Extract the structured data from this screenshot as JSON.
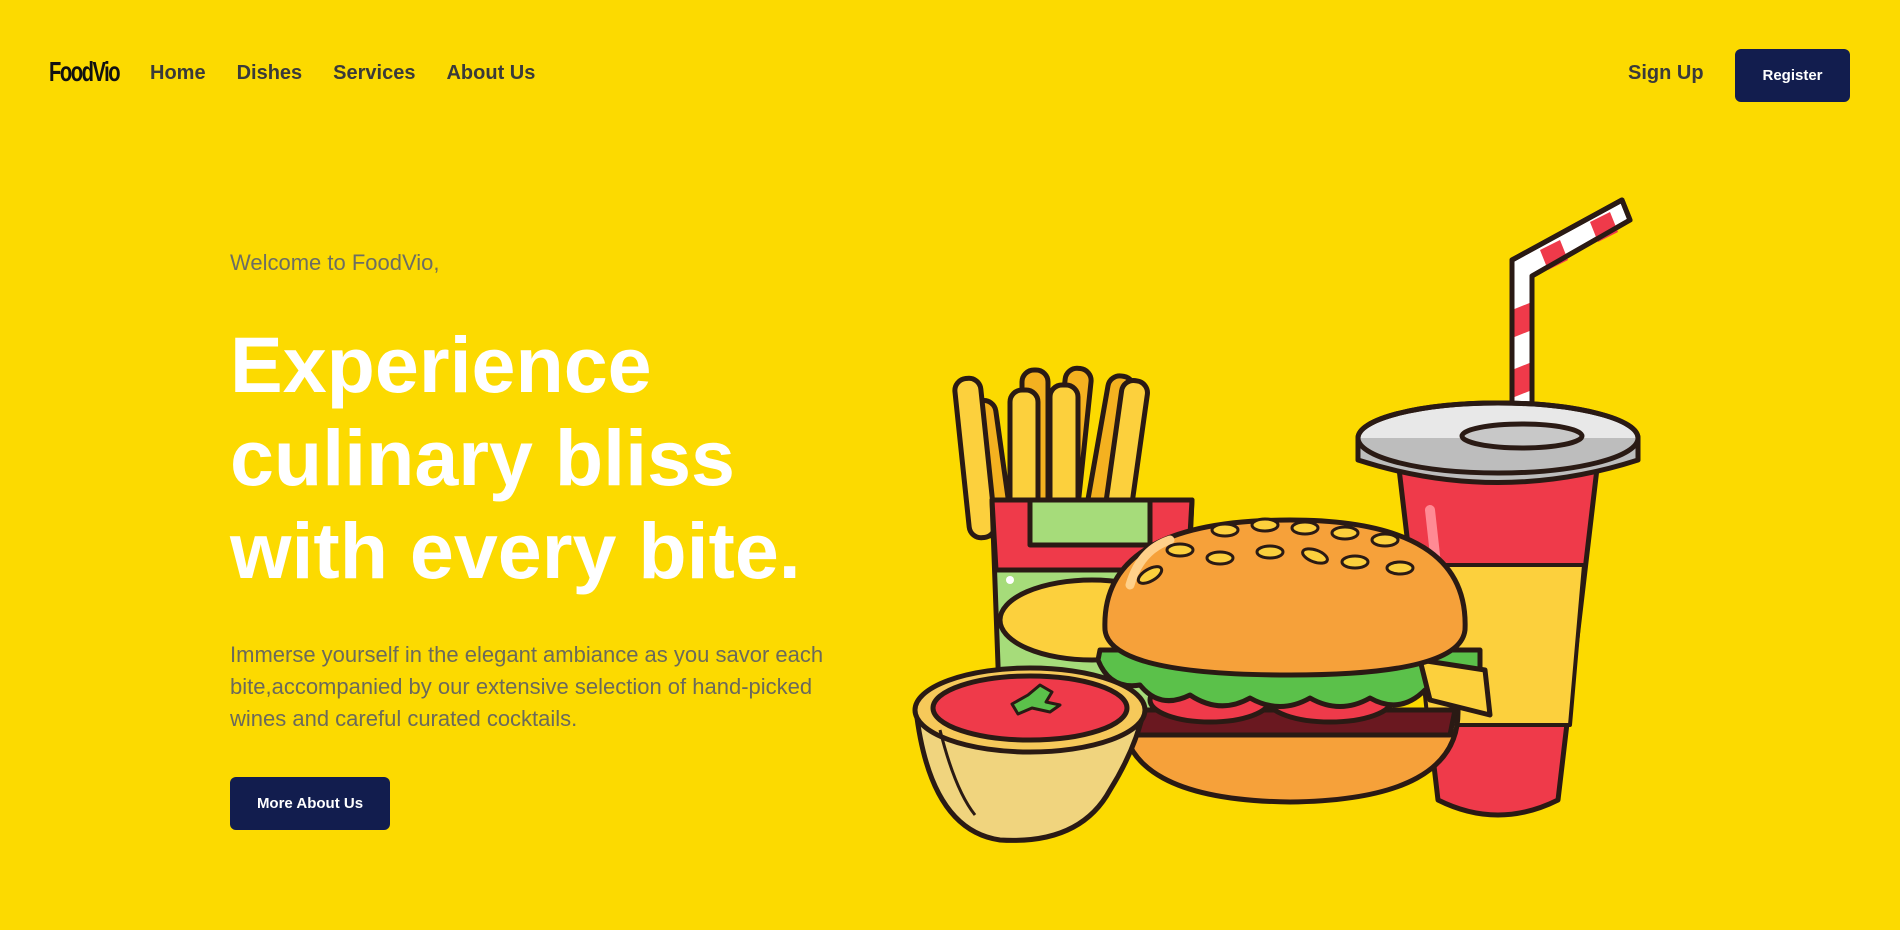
{
  "brand": {
    "logo_text": "FoodVio"
  },
  "nav": {
    "links": [
      {
        "label": "Home"
      },
      {
        "label": "Dishes"
      },
      {
        "label": "Services"
      },
      {
        "label": "About Us"
      }
    ],
    "signup_label": "Sign Up",
    "register_label": "Register"
  },
  "hero": {
    "welcome": "Welcome to FoodVio,",
    "headline": "Experience culinary bliss with every bite.",
    "description": "Immerse yourself in the elegant ambiance as you savor each bite,accompanied by our extensive selection of hand-picked wines and careful curated cocktails.",
    "cta_label": "More About Us"
  },
  "illustration": {
    "items": [
      "fries-icon",
      "burger-icon",
      "soda-cup-icon",
      "ketchup-bowl-icon"
    ]
  },
  "colors": {
    "background": "#FCDA00",
    "button": "#121D4E",
    "headline": "#FFFFFF"
  }
}
